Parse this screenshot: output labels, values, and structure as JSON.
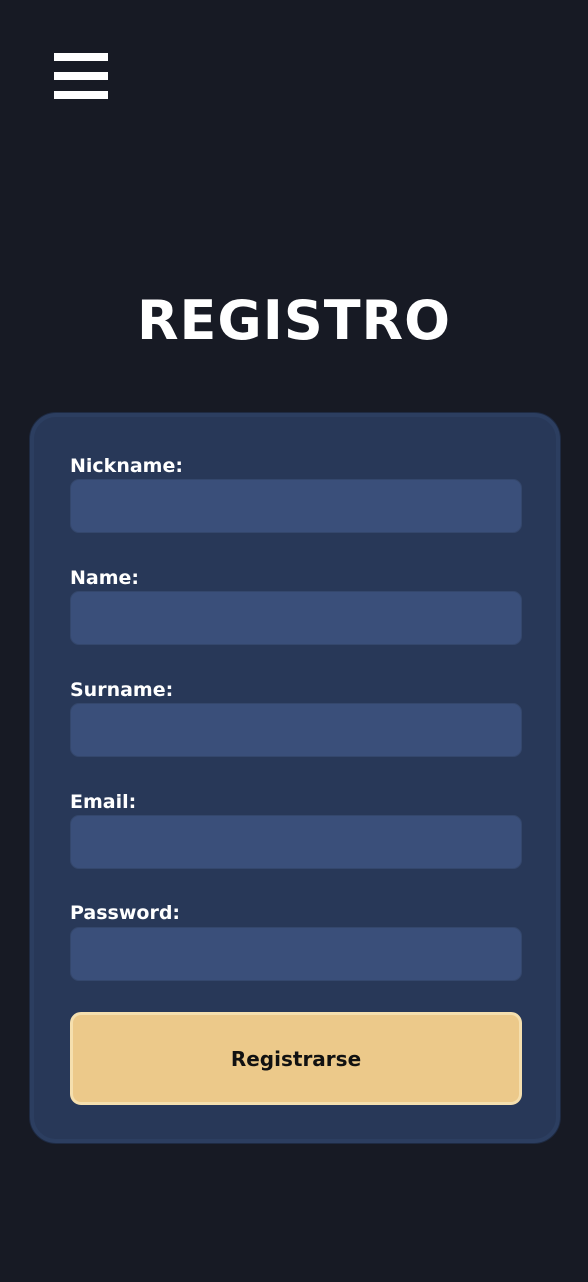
{
  "header": {
    "menu_icon": "hamburger-menu-icon"
  },
  "page": {
    "title": "REGISTRO"
  },
  "form": {
    "fields": [
      {
        "label": "Nickname:",
        "value": "",
        "placeholder": ""
      },
      {
        "label": "Name:",
        "value": "",
        "placeholder": ""
      },
      {
        "label": "Surname:",
        "value": "",
        "placeholder": ""
      },
      {
        "label": "Email:",
        "value": "",
        "placeholder": ""
      },
      {
        "label": "Password:",
        "value": "",
        "placeholder": ""
      }
    ],
    "submit_label": "Registrarse"
  },
  "colors": {
    "background": "#171a24",
    "card": "#283858",
    "input": "#3a4f7a",
    "button": "#ecc98a",
    "text": "#ffffff"
  }
}
